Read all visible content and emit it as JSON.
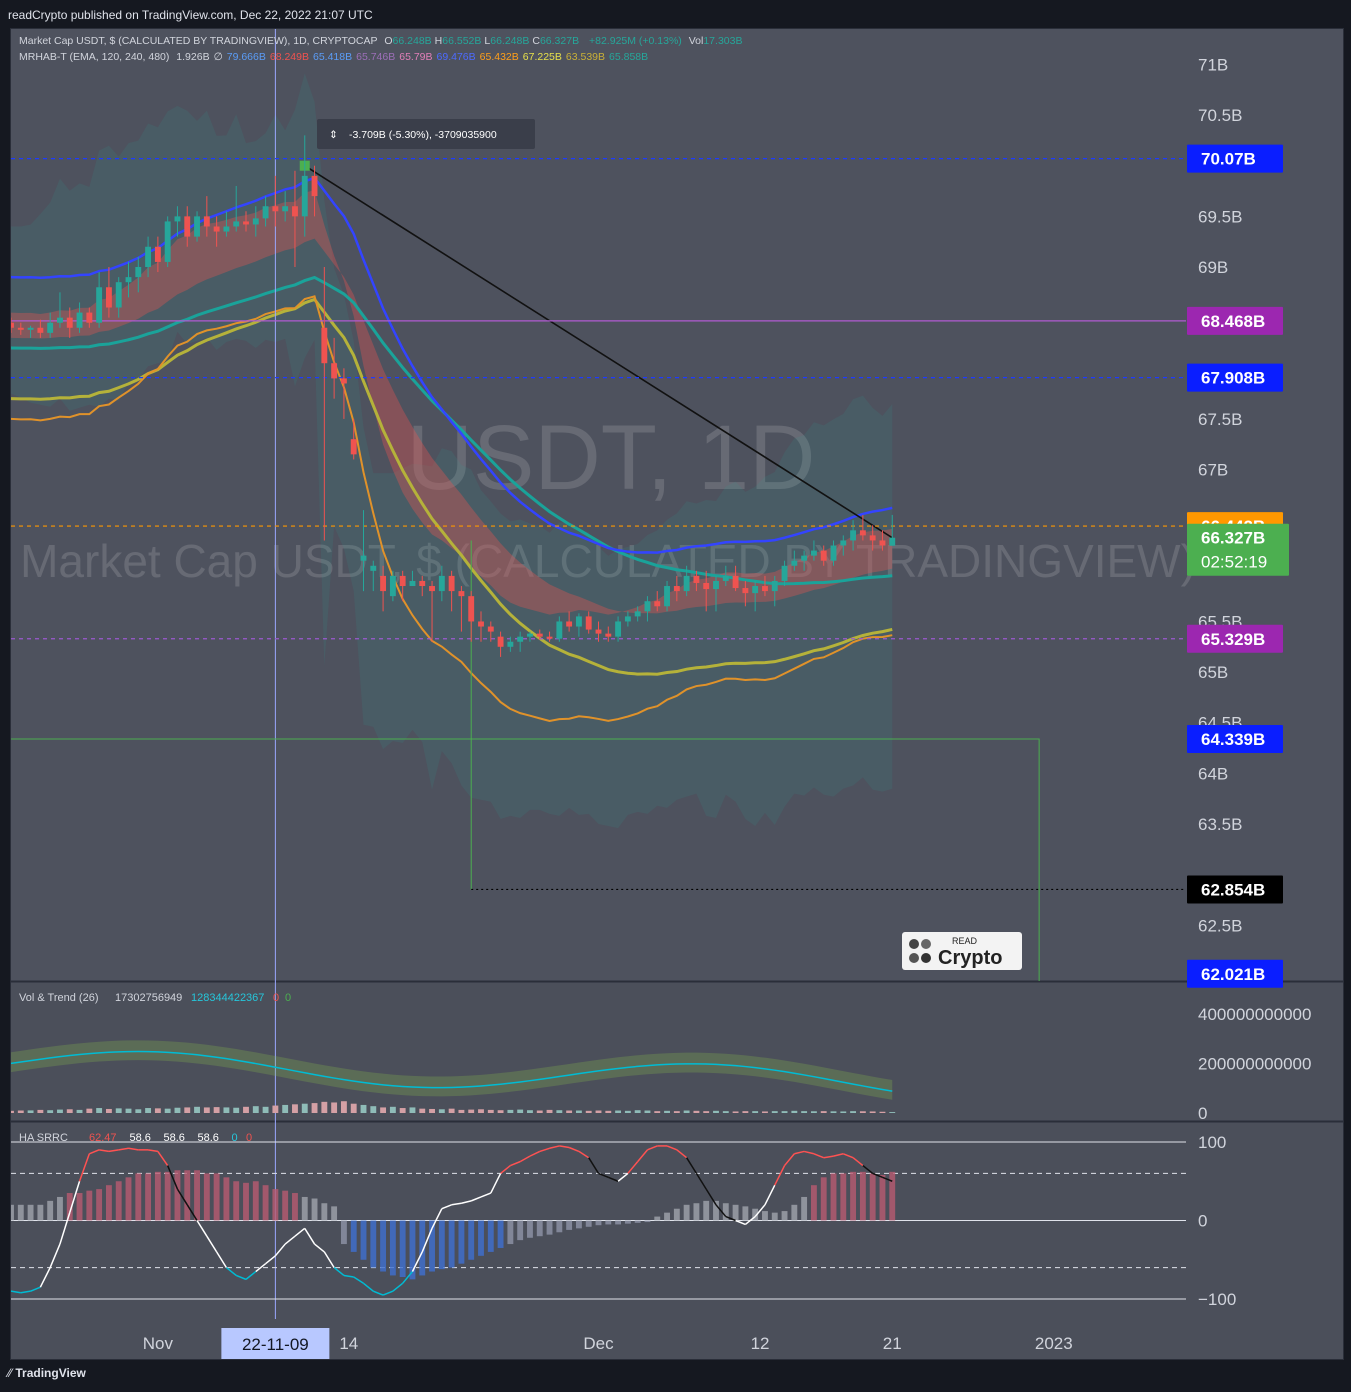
{
  "header": {
    "published": "readCrypto published on TradingView.com, Dec 22, 2022 21:07 UTC"
  },
  "legend": {
    "main_title": "Market Cap USDT, $ (CALCULATED BY TRADINGVIEW), 1D, CRYPTOCAP",
    "ohlc": [
      {
        "k": "O",
        "v": "66.248B"
      },
      {
        "k": "H",
        "v": "66.552B"
      },
      {
        "k": "L",
        "v": "66.248B"
      },
      {
        "k": "C",
        "v": "66.327B"
      }
    ],
    "change": "+82.925M (+0.13%)",
    "vol_label": "Vol",
    "vol_value": "17.303B",
    "indicator_name": "MRHAB-T (EMA, 120, 240, 480)",
    "indicator_vals": [
      {
        "v": "1.926B",
        "c": "#d1d4dc"
      },
      {
        "v": "∅",
        "c": "#d1d4dc"
      },
      {
        "v": "79.666B",
        "c": "#5b9cf6"
      },
      {
        "v": "68.249B",
        "c": "#ef5350"
      },
      {
        "v": "65.418B",
        "c": "#5b9cf6"
      },
      {
        "v": "65.746B",
        "c": "#9c6fb8"
      },
      {
        "v": "65.79B",
        "c": "#e07fb8"
      },
      {
        "v": "69.476B",
        "c": "#4d6bff"
      },
      {
        "v": "65.432B",
        "c": "#ff9f1a"
      },
      {
        "v": "67.225B",
        "c": "#e6e04a"
      },
      {
        "v": "63.539B",
        "c": "#c9b037"
      },
      {
        "v": "65.858B",
        "c": "#26a69a"
      }
    ]
  },
  "watermark": {
    "symbol": "USDT, 1D",
    "name": "Market Cap USDT, $ (CALCULATED BY TRADINGVIEW)"
  },
  "measure_tooltip": "-3.709B (-5.30%), -3709035900",
  "colors": {
    "up": "#26a69a",
    "down": "#ef5350",
    "ma_blue": "#3344ff",
    "ma_yellow": "#b5b23a",
    "ma_orange": "#e0922a",
    "ma_teal": "#1aa39a",
    "purple": "#9c27b0",
    "green_line": "#4caf50"
  },
  "chart_data": [
    {
      "type": "candlestick",
      "title": "Market Cap USDT, $ (CALCULATED BY TRADINGVIEW), 1D, CRYPTOCAP",
      "x_range": [
        "2022-10-22",
        "2023-01-10"
      ],
      "ylim": [
        61.95,
        71.35
      ],
      "price_ticks": [
        "71B",
        "70.5B",
        "69.5B",
        "69B",
        "67.5B",
        "67B",
        "65.5B",
        "65B",
        "64.5B",
        "64B",
        "63.5B",
        "62.5B"
      ],
      "x_ticks": [
        {
          "date": "2022-11-01",
          "label": "Nov"
        },
        {
          "date": "2022-11-14",
          "label": "14"
        },
        {
          "date": "2022-12-01",
          "label": "Dec"
        },
        {
          "date": "2022-12-12",
          "label": "12"
        },
        {
          "date": "2022-12-21",
          "label": "21"
        },
        {
          "date": "2023-01-01",
          "label": "2023"
        }
      ],
      "cursor_date_label": "22-11-09",
      "price_labels": [
        {
          "value": 70.07,
          "text": "70.07B",
          "color": "#0a1eff",
          "line": "dashed-blue"
        },
        {
          "value": 68.468,
          "text": "68.468B",
          "color": "#9c27b0",
          "line": "solid-purple"
        },
        {
          "value": 67.908,
          "text": "67.908B",
          "color": "#0a1eff",
          "line": "dashed-blue"
        },
        {
          "value": 66.442,
          "text": "66.442B",
          "color": "#ff9800",
          "line": "dashed-orange"
        },
        {
          "value": 66.327,
          "text": "66.327B",
          "color": "#4caf50",
          "sub": "02:52:19",
          "line": "none"
        },
        {
          "value": 65.329,
          "text": "65.329B",
          "color": "#9c27b0",
          "line": "dashed-purple"
        },
        {
          "value": 64.339,
          "text": "64.339B",
          "color": "#0a1eff",
          "line": "solid-green"
        },
        {
          "value": 62.854,
          "text": "62.854B",
          "color": "#000000",
          "line": "dotted-black"
        },
        {
          "value": 62.021,
          "text": "62.021B",
          "color": "#0a1eff",
          "line": "none"
        }
      ],
      "candles": [
        {
          "o": 68.45,
          "h": 68.5,
          "l": 68.35,
          "c": 68.4
        },
        {
          "o": 68.4,
          "h": 68.45,
          "l": 68.33,
          "c": 68.38
        },
        {
          "o": 68.38,
          "h": 68.42,
          "l": 68.3,
          "c": 68.4
        },
        {
          "o": 68.4,
          "h": 68.48,
          "l": 68.3,
          "c": 68.35
        },
        {
          "o": 68.35,
          "h": 68.55,
          "l": 68.3,
          "c": 68.45
        },
        {
          "o": 68.45,
          "h": 68.75,
          "l": 68.4,
          "c": 68.5
        },
        {
          "o": 68.5,
          "h": 68.6,
          "l": 68.3,
          "c": 68.4
        },
        {
          "o": 68.4,
          "h": 68.65,
          "l": 68.35,
          "c": 68.55
        },
        {
          "o": 68.55,
          "h": 68.6,
          "l": 68.4,
          "c": 68.45
        },
        {
          "o": 68.45,
          "h": 68.95,
          "l": 68.4,
          "c": 68.8
        },
        {
          "o": 68.8,
          "h": 69.0,
          "l": 68.5,
          "c": 68.6
        },
        {
          "o": 68.6,
          "h": 68.9,
          "l": 68.5,
          "c": 68.85
        },
        {
          "o": 68.85,
          "h": 69.05,
          "l": 68.7,
          "c": 68.9
        },
        {
          "o": 68.9,
          "h": 69.1,
          "l": 68.75,
          "c": 69.0
        },
        {
          "o": 69.0,
          "h": 69.3,
          "l": 68.9,
          "c": 69.2
        },
        {
          "o": 69.2,
          "h": 69.3,
          "l": 68.95,
          "c": 69.05
        },
        {
          "o": 69.05,
          "h": 69.5,
          "l": 69.0,
          "c": 69.45
        },
        {
          "o": 69.45,
          "h": 69.6,
          "l": 69.3,
          "c": 69.5
        },
        {
          "o": 69.5,
          "h": 69.6,
          "l": 69.2,
          "c": 69.3
        },
        {
          "o": 69.3,
          "h": 69.55,
          "l": 69.25,
          "c": 69.5
        },
        {
          "o": 69.5,
          "h": 69.7,
          "l": 69.3,
          "c": 69.4
        },
        {
          "o": 69.4,
          "h": 69.5,
          "l": 69.2,
          "c": 69.35
        },
        {
          "o": 69.35,
          "h": 69.55,
          "l": 69.3,
          "c": 69.4
        },
        {
          "o": 69.4,
          "h": 69.8,
          "l": 69.35,
          "c": 69.45
        },
        {
          "o": 69.45,
          "h": 69.55,
          "l": 69.35,
          "c": 69.42
        },
        {
          "o": 69.42,
          "h": 69.6,
          "l": 69.3,
          "c": 69.48
        },
        {
          "o": 69.48,
          "h": 69.7,
          "l": 69.4,
          "c": 69.6
        },
        {
          "o": 69.6,
          "h": 69.9,
          "l": 69.4,
          "c": 69.55
        },
        {
          "o": 69.55,
          "h": 69.75,
          "l": 69.45,
          "c": 69.6
        },
        {
          "o": 69.6,
          "h": 69.95,
          "l": 69.0,
          "c": 69.5
        },
        {
          "o": 69.5,
          "h": 70.3,
          "l": 69.3,
          "c": 69.9
        },
        {
          "o": 69.9,
          "h": 70.0,
          "l": 69.5,
          "c": 69.7
        },
        {
          "o": 68.4,
          "h": 69.0,
          "l": 66.3,
          "c": 68.05
        },
        {
          "o": 68.05,
          "h": 68.3,
          "l": 67.7,
          "c": 67.9
        },
        {
          "o": 67.9,
          "h": 68.0,
          "l": 67.5,
          "c": 67.85
        },
        {
          "o": 67.3,
          "h": 67.5,
          "l": 67.1,
          "c": 67.15
        },
        {
          "o": 66.1,
          "h": 66.6,
          "l": 65.8,
          "c": 66.15
        },
        {
          "o": 66.0,
          "h": 66.1,
          "l": 65.8,
          "c": 66.05
        },
        {
          "o": 65.95,
          "h": 66.05,
          "l": 65.6,
          "c": 65.8
        },
        {
          "o": 65.75,
          "h": 66.0,
          "l": 65.7,
          "c": 65.95
        },
        {
          "o": 65.95,
          "h": 66.0,
          "l": 65.7,
          "c": 65.85
        },
        {
          "o": 65.85,
          "h": 66.0,
          "l": 65.85,
          "c": 65.9
        },
        {
          "o": 65.9,
          "h": 65.95,
          "l": 65.75,
          "c": 65.85
        },
        {
          "o": 65.85,
          "h": 65.9,
          "l": 65.3,
          "c": 65.8
        },
        {
          "o": 65.8,
          "h": 66.05,
          "l": 65.7,
          "c": 65.95
        },
        {
          "o": 65.95,
          "h": 66.0,
          "l": 65.6,
          "c": 65.8
        },
        {
          "o": 65.8,
          "h": 65.85,
          "l": 65.4,
          "c": 65.75
        },
        {
          "o": 65.75,
          "h": 65.8,
          "l": 65.3,
          "c": 65.5
        },
        {
          "o": 65.5,
          "h": 65.6,
          "l": 65.3,
          "c": 65.45
        },
        {
          "o": 65.45,
          "h": 65.5,
          "l": 65.3,
          "c": 65.4
        },
        {
          "o": 65.35,
          "h": 65.4,
          "l": 65.15,
          "c": 65.25
        },
        {
          "o": 65.25,
          "h": 65.35,
          "l": 65.2,
          "c": 65.3
        },
        {
          "o": 65.3,
          "h": 65.4,
          "l": 65.2,
          "c": 65.35
        },
        {
          "o": 65.35,
          "h": 65.4,
          "l": 65.3,
          "c": 65.38
        },
        {
          "o": 65.38,
          "h": 65.42,
          "l": 65.32,
          "c": 65.35
        },
        {
          "o": 65.35,
          "h": 65.4,
          "l": 65.3,
          "c": 65.33
        },
        {
          "o": 65.33,
          "h": 65.55,
          "l": 65.3,
          "c": 65.5
        },
        {
          "o": 65.5,
          "h": 65.6,
          "l": 65.4,
          "c": 65.45
        },
        {
          "o": 65.45,
          "h": 65.58,
          "l": 65.35,
          "c": 65.55
        },
        {
          "o": 65.55,
          "h": 65.6,
          "l": 65.38,
          "c": 65.42
        },
        {
          "o": 65.42,
          "h": 65.5,
          "l": 65.3,
          "c": 65.38
        },
        {
          "o": 65.38,
          "h": 65.45,
          "l": 65.3,
          "c": 65.35
        },
        {
          "o": 65.35,
          "h": 65.55,
          "l": 65.3,
          "c": 65.5
        },
        {
          "o": 65.5,
          "h": 65.6,
          "l": 65.45,
          "c": 65.55
        },
        {
          "o": 65.55,
          "h": 65.65,
          "l": 65.5,
          "c": 65.6
        },
        {
          "o": 65.6,
          "h": 65.75,
          "l": 65.5,
          "c": 65.7
        },
        {
          "o": 65.7,
          "h": 65.8,
          "l": 65.6,
          "c": 65.65
        },
        {
          "o": 65.65,
          "h": 65.9,
          "l": 65.6,
          "c": 65.85
        },
        {
          "o": 65.85,
          "h": 65.95,
          "l": 65.7,
          "c": 65.8
        },
        {
          "o": 65.8,
          "h": 66.05,
          "l": 65.75,
          "c": 65.95
        },
        {
          "o": 65.95,
          "h": 66.0,
          "l": 65.8,
          "c": 65.88
        },
        {
          "o": 65.88,
          "h": 66.0,
          "l": 65.6,
          "c": 65.82
        },
        {
          "o": 65.82,
          "h": 65.95,
          "l": 65.6,
          "c": 65.9
        },
        {
          "o": 65.9,
          "h": 66.05,
          "l": 65.85,
          "c": 65.95
        },
        {
          "o": 65.95,
          "h": 66.05,
          "l": 65.8,
          "c": 65.83
        },
        {
          "o": 65.83,
          "h": 65.9,
          "l": 65.65,
          "c": 65.78
        },
        {
          "o": 65.78,
          "h": 65.9,
          "l": 65.6,
          "c": 65.85
        },
        {
          "o": 65.85,
          "h": 65.95,
          "l": 65.75,
          "c": 65.8
        },
        {
          "o": 65.8,
          "h": 65.95,
          "l": 65.65,
          "c": 65.9
        },
        {
          "o": 65.9,
          "h": 66.1,
          "l": 65.85,
          "c": 66.05
        },
        {
          "o": 66.05,
          "h": 66.2,
          "l": 66.0,
          "c": 66.1
        },
        {
          "o": 66.1,
          "h": 66.2,
          "l": 66.0,
          "c": 66.15
        },
        {
          "o": 66.15,
          "h": 66.3,
          "l": 66.1,
          "c": 66.2
        },
        {
          "o": 66.2,
          "h": 66.25,
          "l": 66.05,
          "c": 66.1
        },
        {
          "o": 66.1,
          "h": 66.3,
          "l": 66.05,
          "c": 66.25
        },
        {
          "o": 66.25,
          "h": 66.35,
          "l": 66.15,
          "c": 66.3
        },
        {
          "o": 66.3,
          "h": 66.5,
          "l": 66.2,
          "c": 66.4
        },
        {
          "o": 66.4,
          "h": 66.55,
          "l": 66.3,
          "c": 66.35
        },
        {
          "o": 66.35,
          "h": 66.45,
          "l": 66.2,
          "c": 66.3
        },
        {
          "o": 66.3,
          "h": 66.4,
          "l": 66.2,
          "c": 66.25
        },
        {
          "o": 66.248,
          "h": 66.552,
          "l": 66.248,
          "c": 66.327
        }
      ]
    },
    {
      "type": "bar",
      "title": "Vol & Trend (26)",
      "legend_values": [
        "17302756949",
        "128344422367",
        "0",
        "0"
      ],
      "ylim": [
        0,
        480000000000
      ],
      "y_ticks": [
        "400000000000",
        "200000000000",
        "0"
      ],
      "values": [
        0.35,
        0.4,
        0.42,
        0.5,
        0.45,
        0.55,
        0.6,
        0.5,
        0.7,
        0.8,
        0.65,
        0.75,
        0.7,
        0.6,
        0.8,
        0.75,
        0.7,
        0.85,
        0.9,
        1.0,
        0.9,
        0.95,
        0.9,
        0.85,
        1.0,
        1.1,
        1.0,
        1.2,
        1.3,
        1.4,
        1.5,
        1.6,
        1.8,
        1.7,
        1.9,
        1.5,
        1.3,
        1.1,
        0.9,
        1.0,
        0.8,
        0.9,
        0.7,
        0.65,
        0.6,
        0.7,
        0.5,
        0.55,
        0.6,
        0.5,
        0.45,
        0.5,
        0.55,
        0.45,
        0.4,
        0.5,
        0.45,
        0.4,
        0.4,
        0.35,
        0.4,
        0.35,
        0.4,
        0.35,
        0.45,
        0.4,
        0.3,
        0.35,
        0.3,
        0.4,
        0.35,
        0.3,
        0.35,
        0.3,
        0.25,
        0.3,
        0.3,
        0.25,
        0.3,
        0.3,
        0.35,
        0.3,
        0.28,
        0.3,
        0.27,
        0.25,
        0.3,
        0.28,
        0.25,
        0.2,
        0.15
      ],
      "unit": "x10^10"
    },
    {
      "type": "bar",
      "title": "HA SRRC",
      "legend_values": [
        "62.47",
        "58.6",
        "58.6",
        "58.6",
        "0",
        "0"
      ],
      "ylim": [
        -100,
        100
      ],
      "y_ticks": [
        "100",
        "0",
        "−100"
      ],
      "values": [
        20,
        20,
        20,
        20,
        25,
        30,
        35,
        35,
        38,
        40,
        45,
        50,
        55,
        60,
        60,
        62,
        62,
        64,
        64,
        64,
        60,
        60,
        55,
        50,
        48,
        50,
        45,
        40,
        38,
        35,
        30,
        28,
        22,
        18,
        -30,
        -40,
        -50,
        -60,
        -65,
        -70,
        -72,
        -75,
        -70,
        -65,
        -62,
        -60,
        -55,
        -50,
        -45,
        -40,
        -35,
        -30,
        -25,
        -22,
        -20,
        -18,
        -15,
        -12,
        -10,
        -8,
        -6,
        -5,
        -5,
        -4,
        -3,
        -2,
        5,
        10,
        15,
        20,
        22,
        25,
        25,
        22,
        20,
        18,
        15,
        12,
        10,
        12,
        20,
        30,
        45,
        55,
        60,
        60,
        62,
        62,
        60,
        58,
        62
      ],
      "line": [
        -90,
        -92,
        -90,
        -85,
        -60,
        -30,
        10,
        50,
        85,
        90,
        88,
        90,
        92,
        90,
        90,
        88,
        70,
        40,
        20,
        0,
        -20,
        -40,
        -60,
        -70,
        -75,
        -65,
        -55,
        -45,
        -30,
        -20,
        -10,
        -30,
        -40,
        -60,
        -70,
        -72,
        -80,
        -90,
        -95,
        -90,
        -80,
        -65,
        -40,
        -10,
        15,
        20,
        22,
        25,
        30,
        35,
        60,
        70,
        75,
        82,
        88,
        92,
        95,
        93,
        88,
        80,
        60,
        55,
        50,
        60,
        75,
        90,
        95,
        95,
        90,
        80,
        60,
        40,
        20,
        5,
        0,
        -5,
        5,
        20,
        45,
        70,
        85,
        88,
        85,
        80,
        82,
        85,
        80,
        70,
        60,
        55,
        50
      ]
    }
  ]
}
